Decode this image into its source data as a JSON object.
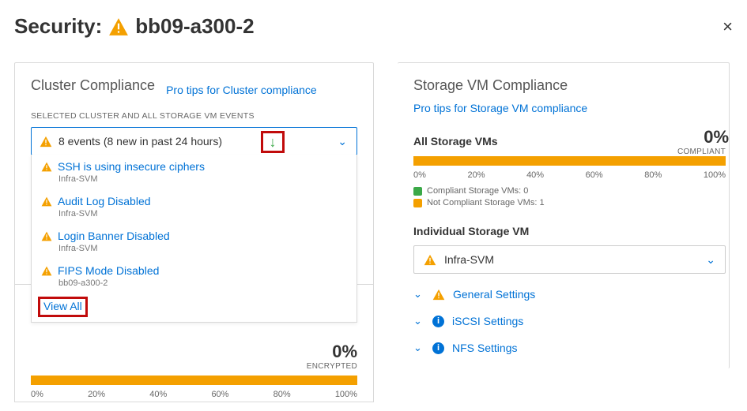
{
  "header": {
    "prefix": "Security:",
    "title": "bb09-a300-2"
  },
  "left": {
    "title": "Cluster Compliance",
    "tips_link": "Pro tips for Cluster compliance",
    "subhead": "SELECTED CLUSTER AND ALL STORAGE VM EVENTS",
    "dropdown_text": "8 events (8 new in past 24 hours)",
    "events": [
      {
        "title": "SSH is using insecure ciphers",
        "sub": "Infra-SVM"
      },
      {
        "title": "Audit Log Disabled",
        "sub": "Infra-SVM"
      },
      {
        "title": "Login Banner Disabled",
        "sub": "Infra-SVM"
      },
      {
        "title": "FIPS Mode Disabled",
        "sub": "bb09-a300-2"
      }
    ],
    "view_all": "View All"
  },
  "encrypted": {
    "pct": "0%",
    "label": "ENCRYPTED",
    "ticks": [
      "0%",
      "20%",
      "40%",
      "60%",
      "80%",
      "100%"
    ]
  },
  "right": {
    "title": "Storage VM Compliance",
    "tips_link": "Pro tips for Storage VM compliance",
    "all_label": "All Storage VMs",
    "pct": "0%",
    "compliant_label": "COMPLIANT",
    "ticks": [
      "0%",
      "20%",
      "40%",
      "60%",
      "80%",
      "100%"
    ],
    "legend": {
      "compliant": "Compliant Storage VMs: 0",
      "noncompliant": "Not Compliant Storage VMs: 1"
    },
    "indiv_label": "Individual Storage VM",
    "selected_svm": "Infra-SVM",
    "settings": [
      {
        "icon": "warn",
        "label": "General Settings"
      },
      {
        "icon": "info",
        "label": "iSCSI Settings"
      },
      {
        "icon": "info",
        "label": "NFS Settings"
      }
    ]
  }
}
